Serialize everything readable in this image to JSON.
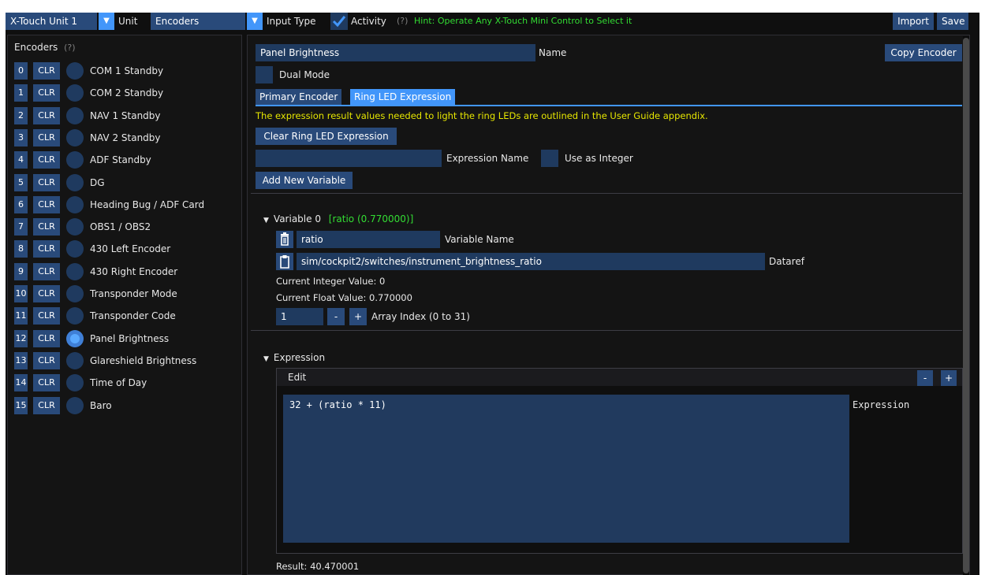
{
  "toolbar": {
    "unit_select": "X-Touch Unit 1",
    "unit_label": "Unit",
    "input_type_select": "Encoders",
    "input_type_label": "Input Type",
    "activity_label": "Activity",
    "help_mark": "(?)",
    "hint": "Hint: Operate Any X-Touch Mini Control to Select it",
    "import_label": "Import",
    "save_label": "Save"
  },
  "sidebar": {
    "title": "Encoders",
    "help_mark": "(?)",
    "clr_label": "CLR",
    "items": [
      {
        "index": "0",
        "name": "COM 1 Standby",
        "selected": false
      },
      {
        "index": "1",
        "name": "COM 2 Standby",
        "selected": false
      },
      {
        "index": "2",
        "name": "NAV 1 Standby",
        "selected": false
      },
      {
        "index": "3",
        "name": "NAV 2 Standby",
        "selected": false
      },
      {
        "index": "4",
        "name": "ADF Standby",
        "selected": false
      },
      {
        "index": "5",
        "name": "DG",
        "selected": false
      },
      {
        "index": "6",
        "name": "Heading Bug / ADF Card",
        "selected": false
      },
      {
        "index": "7",
        "name": "OBS1 / OBS2",
        "selected": false
      },
      {
        "index": "8",
        "name": "430 Left Encoder",
        "selected": false
      },
      {
        "index": "9",
        "name": "430 Right Encoder",
        "selected": false
      },
      {
        "index": "10",
        "name": "Transponder Mode",
        "selected": false
      },
      {
        "index": "11",
        "name": "Transponder Code",
        "selected": false
      },
      {
        "index": "12",
        "name": "Panel Brightness",
        "selected": true
      },
      {
        "index": "13",
        "name": "Glareshield Brightness",
        "selected": false
      },
      {
        "index": "14",
        "name": "Time of Day",
        "selected": false
      },
      {
        "index": "15",
        "name": "Baro",
        "selected": false
      }
    ]
  },
  "main": {
    "name_value": "Panel Brightness",
    "name_label": "Name",
    "copy_encoder_label": "Copy Encoder",
    "dual_mode_label": "Dual Mode",
    "tabs": [
      {
        "label": "Primary Encoder",
        "active": false
      },
      {
        "label": "Ring LED Expression",
        "active": true
      }
    ],
    "info_text": "The expression result values needed to light the ring LEDs are outlined in the User Guide appendix.",
    "clear_button_label": "Clear Ring LED Expression",
    "expression_name_value": "",
    "expression_name_label": "Expression Name",
    "use_as_integer_label": "Use as Integer",
    "add_variable_label": "Add New Variable",
    "variable": {
      "header": "Variable 0",
      "header_value": "[ratio (0.770000)]",
      "name_value": "ratio",
      "name_label": "Variable Name",
      "dataref_value": "sim/cockpit2/switches/instrument_brightness_ratio",
      "dataref_label": "Dataref",
      "current_int": "Current Integer Value: 0",
      "current_float": "Current Float Value: 0.770000",
      "array_index_value": "1",
      "minus": "-",
      "plus": "+",
      "array_index_label": "Array Index (0 to 31)"
    },
    "expression": {
      "header": "Expression",
      "edit_label": "Edit",
      "minus": "-",
      "plus": "+",
      "text": "32 + (ratio * 11)",
      "label": "Expression",
      "result": "Result: 40.470001"
    }
  },
  "colors": {
    "background": "#0f0f0f",
    "button": "#294a7a",
    "accent": "#4296fa",
    "hint_green": "#33dd33",
    "info_yellow": "#e6e600"
  }
}
